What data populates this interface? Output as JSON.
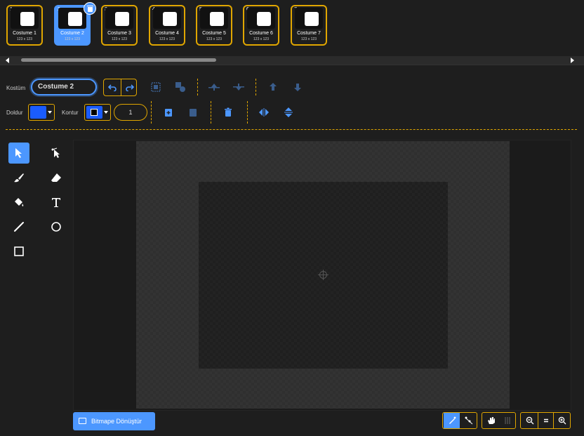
{
  "costumes": [
    {
      "num": "1",
      "name": "Costume 1",
      "size": "123 x 123"
    },
    {
      "num": "2",
      "name": "Costume 2",
      "size": "123 x 123"
    },
    {
      "num": "3",
      "name": "Costume 3",
      "size": "123 x 123"
    },
    {
      "num": "4",
      "name": "Costume 4",
      "size": "123 x 123"
    },
    {
      "num": "5",
      "name": "Costume 5",
      "size": "123 x 123"
    },
    {
      "num": "6",
      "name": "Costume 6",
      "size": "123 x 123"
    },
    {
      "num": "7",
      "name": "Costume 7",
      "size": "123 x 123"
    }
  ],
  "selected_costume": "2",
  "toolbar": {
    "costume_label": "Kostüm",
    "costume_name_value": "Costume 2",
    "fill_label": "Doldur",
    "outline_label": "Kontur",
    "stroke_width": "1",
    "fill_color": "#1a5cff",
    "outline_color": "#000000"
  },
  "convert_button_label": "Bitmape Dönüştür",
  "icons": {
    "undo": "undo-icon",
    "redo": "redo-icon",
    "group": "group-icon",
    "ungroup": "ungroup-icon",
    "forward": "forward-icon",
    "backward": "backward-icon",
    "front": "front-icon",
    "back": "back-icon",
    "copy": "copy-icon",
    "paste": "paste-icon",
    "delete": "delete-icon",
    "flip_h": "flip-horizontal-icon",
    "flip_v": "flip-vertical-icon"
  },
  "colors": {
    "accent": "#4c97ff",
    "outline_orange": "#e0a600",
    "background": "#1e1e1e"
  }
}
